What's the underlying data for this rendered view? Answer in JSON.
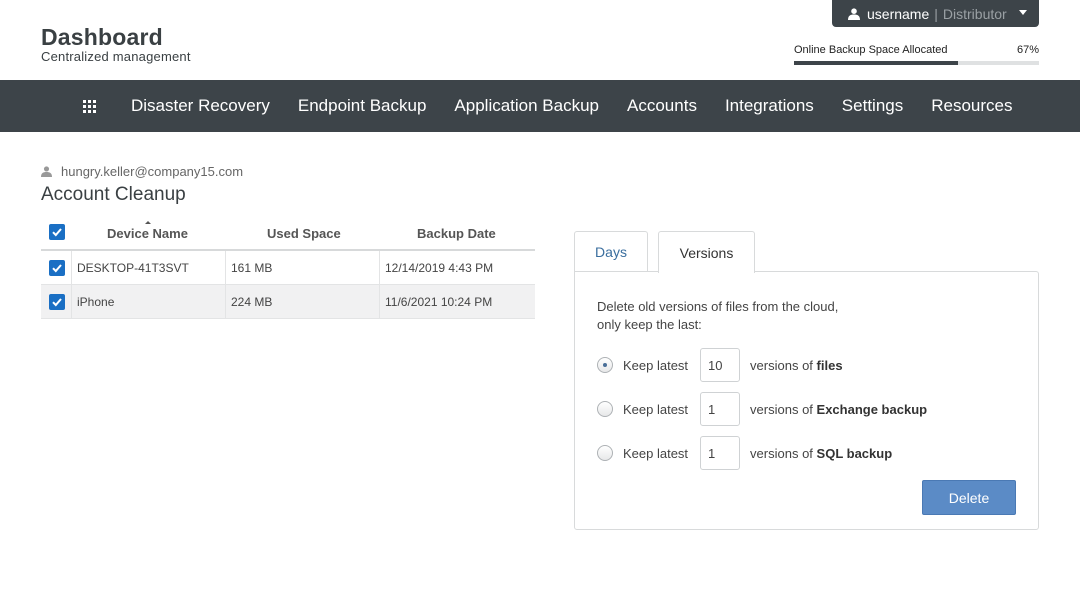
{
  "header": {
    "title": "Dashboard",
    "subtitle": "Centralized management",
    "user": {
      "username": "username",
      "separator": "|",
      "role": "Distributor"
    },
    "storage": {
      "label": "Online Backup Space Allocated",
      "percent_label": "67%",
      "percent": 67
    }
  },
  "nav": {
    "items": [
      {
        "label": "Disaster Recovery"
      },
      {
        "label": "Endpoint Backup"
      },
      {
        "label": "Application Backup"
      },
      {
        "label": "Accounts"
      },
      {
        "label": "Integrations"
      },
      {
        "label": "Settings"
      },
      {
        "label": "Resources"
      }
    ]
  },
  "account": {
    "email": "hungry.keller@company15.com",
    "title": "Account Cleanup"
  },
  "table": {
    "columns": [
      "Device Name",
      "Used Space",
      "Backup Date"
    ],
    "rows": [
      {
        "device": "DESKTOP-41T3SVT",
        "used": "161 MB",
        "date": "12/14/2019 4:43 PM"
      },
      {
        "device": "iPhone",
        "used": "224 MB",
        "date": "11/6/2021 10:24 PM"
      }
    ]
  },
  "tabs": {
    "days": "Days",
    "versions": "Versions"
  },
  "panel": {
    "description_line1": "Delete old versions of files from the cloud,",
    "description_line2": "only keep the last:",
    "options": [
      {
        "prefix": "Keep latest",
        "value": "10",
        "suffix_pre": "versions of ",
        "suffix_bold": "files",
        "selected": true
      },
      {
        "prefix": "Keep latest",
        "value": "1",
        "suffix_pre": "versions of ",
        "suffix_bold": "Exchange backup",
        "selected": false
      },
      {
        "prefix": "Keep latest",
        "value": "1",
        "suffix_pre": "versions of ",
        "suffix_bold": "SQL backup",
        "selected": false
      }
    ],
    "delete_label": "Delete"
  },
  "colors": {
    "nav_bg": "#3d4449",
    "accent": "#1a6fc4",
    "button": "#5b8bc6"
  }
}
